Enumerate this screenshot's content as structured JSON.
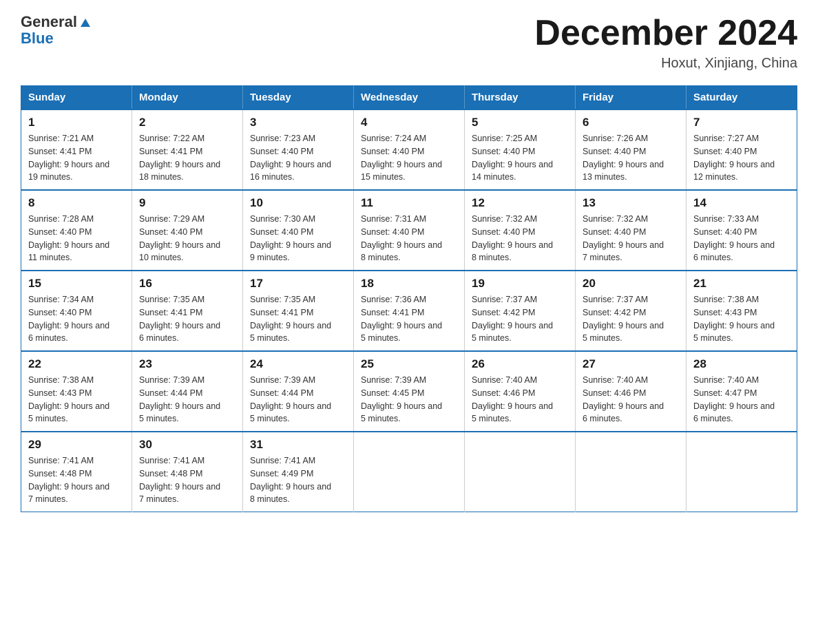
{
  "header": {
    "logo_general": "General",
    "logo_blue": "Blue",
    "title": "December 2024",
    "subtitle": "Hoxut, Xinjiang, China"
  },
  "calendar": {
    "days_of_week": [
      "Sunday",
      "Monday",
      "Tuesday",
      "Wednesday",
      "Thursday",
      "Friday",
      "Saturday"
    ],
    "weeks": [
      [
        {
          "day": "1",
          "sunrise": "Sunrise: 7:21 AM",
          "sunset": "Sunset: 4:41 PM",
          "daylight": "Daylight: 9 hours and 19 minutes."
        },
        {
          "day": "2",
          "sunrise": "Sunrise: 7:22 AM",
          "sunset": "Sunset: 4:41 PM",
          "daylight": "Daylight: 9 hours and 18 minutes."
        },
        {
          "day": "3",
          "sunrise": "Sunrise: 7:23 AM",
          "sunset": "Sunset: 4:40 PM",
          "daylight": "Daylight: 9 hours and 16 minutes."
        },
        {
          "day": "4",
          "sunrise": "Sunrise: 7:24 AM",
          "sunset": "Sunset: 4:40 PM",
          "daylight": "Daylight: 9 hours and 15 minutes."
        },
        {
          "day": "5",
          "sunrise": "Sunrise: 7:25 AM",
          "sunset": "Sunset: 4:40 PM",
          "daylight": "Daylight: 9 hours and 14 minutes."
        },
        {
          "day": "6",
          "sunrise": "Sunrise: 7:26 AM",
          "sunset": "Sunset: 4:40 PM",
          "daylight": "Daylight: 9 hours and 13 minutes."
        },
        {
          "day": "7",
          "sunrise": "Sunrise: 7:27 AM",
          "sunset": "Sunset: 4:40 PM",
          "daylight": "Daylight: 9 hours and 12 minutes."
        }
      ],
      [
        {
          "day": "8",
          "sunrise": "Sunrise: 7:28 AM",
          "sunset": "Sunset: 4:40 PM",
          "daylight": "Daylight: 9 hours and 11 minutes."
        },
        {
          "day": "9",
          "sunrise": "Sunrise: 7:29 AM",
          "sunset": "Sunset: 4:40 PM",
          "daylight": "Daylight: 9 hours and 10 minutes."
        },
        {
          "day": "10",
          "sunrise": "Sunrise: 7:30 AM",
          "sunset": "Sunset: 4:40 PM",
          "daylight": "Daylight: 9 hours and 9 minutes."
        },
        {
          "day": "11",
          "sunrise": "Sunrise: 7:31 AM",
          "sunset": "Sunset: 4:40 PM",
          "daylight": "Daylight: 9 hours and 8 minutes."
        },
        {
          "day": "12",
          "sunrise": "Sunrise: 7:32 AM",
          "sunset": "Sunset: 4:40 PM",
          "daylight": "Daylight: 9 hours and 8 minutes."
        },
        {
          "day": "13",
          "sunrise": "Sunrise: 7:32 AM",
          "sunset": "Sunset: 4:40 PM",
          "daylight": "Daylight: 9 hours and 7 minutes."
        },
        {
          "day": "14",
          "sunrise": "Sunrise: 7:33 AM",
          "sunset": "Sunset: 4:40 PM",
          "daylight": "Daylight: 9 hours and 6 minutes."
        }
      ],
      [
        {
          "day": "15",
          "sunrise": "Sunrise: 7:34 AM",
          "sunset": "Sunset: 4:40 PM",
          "daylight": "Daylight: 9 hours and 6 minutes."
        },
        {
          "day": "16",
          "sunrise": "Sunrise: 7:35 AM",
          "sunset": "Sunset: 4:41 PM",
          "daylight": "Daylight: 9 hours and 6 minutes."
        },
        {
          "day": "17",
          "sunrise": "Sunrise: 7:35 AM",
          "sunset": "Sunset: 4:41 PM",
          "daylight": "Daylight: 9 hours and 5 minutes."
        },
        {
          "day": "18",
          "sunrise": "Sunrise: 7:36 AM",
          "sunset": "Sunset: 4:41 PM",
          "daylight": "Daylight: 9 hours and 5 minutes."
        },
        {
          "day": "19",
          "sunrise": "Sunrise: 7:37 AM",
          "sunset": "Sunset: 4:42 PM",
          "daylight": "Daylight: 9 hours and 5 minutes."
        },
        {
          "day": "20",
          "sunrise": "Sunrise: 7:37 AM",
          "sunset": "Sunset: 4:42 PM",
          "daylight": "Daylight: 9 hours and 5 minutes."
        },
        {
          "day": "21",
          "sunrise": "Sunrise: 7:38 AM",
          "sunset": "Sunset: 4:43 PM",
          "daylight": "Daylight: 9 hours and 5 minutes."
        }
      ],
      [
        {
          "day": "22",
          "sunrise": "Sunrise: 7:38 AM",
          "sunset": "Sunset: 4:43 PM",
          "daylight": "Daylight: 9 hours and 5 minutes."
        },
        {
          "day": "23",
          "sunrise": "Sunrise: 7:39 AM",
          "sunset": "Sunset: 4:44 PM",
          "daylight": "Daylight: 9 hours and 5 minutes."
        },
        {
          "day": "24",
          "sunrise": "Sunrise: 7:39 AM",
          "sunset": "Sunset: 4:44 PM",
          "daylight": "Daylight: 9 hours and 5 minutes."
        },
        {
          "day": "25",
          "sunrise": "Sunrise: 7:39 AM",
          "sunset": "Sunset: 4:45 PM",
          "daylight": "Daylight: 9 hours and 5 minutes."
        },
        {
          "day": "26",
          "sunrise": "Sunrise: 7:40 AM",
          "sunset": "Sunset: 4:46 PM",
          "daylight": "Daylight: 9 hours and 5 minutes."
        },
        {
          "day": "27",
          "sunrise": "Sunrise: 7:40 AM",
          "sunset": "Sunset: 4:46 PM",
          "daylight": "Daylight: 9 hours and 6 minutes."
        },
        {
          "day": "28",
          "sunrise": "Sunrise: 7:40 AM",
          "sunset": "Sunset: 4:47 PM",
          "daylight": "Daylight: 9 hours and 6 minutes."
        }
      ],
      [
        {
          "day": "29",
          "sunrise": "Sunrise: 7:41 AM",
          "sunset": "Sunset: 4:48 PM",
          "daylight": "Daylight: 9 hours and 7 minutes."
        },
        {
          "day": "30",
          "sunrise": "Sunrise: 7:41 AM",
          "sunset": "Sunset: 4:48 PM",
          "daylight": "Daylight: 9 hours and 7 minutes."
        },
        {
          "day": "31",
          "sunrise": "Sunrise: 7:41 AM",
          "sunset": "Sunset: 4:49 PM",
          "daylight": "Daylight: 9 hours and 8 minutes."
        },
        null,
        null,
        null,
        null
      ]
    ]
  }
}
